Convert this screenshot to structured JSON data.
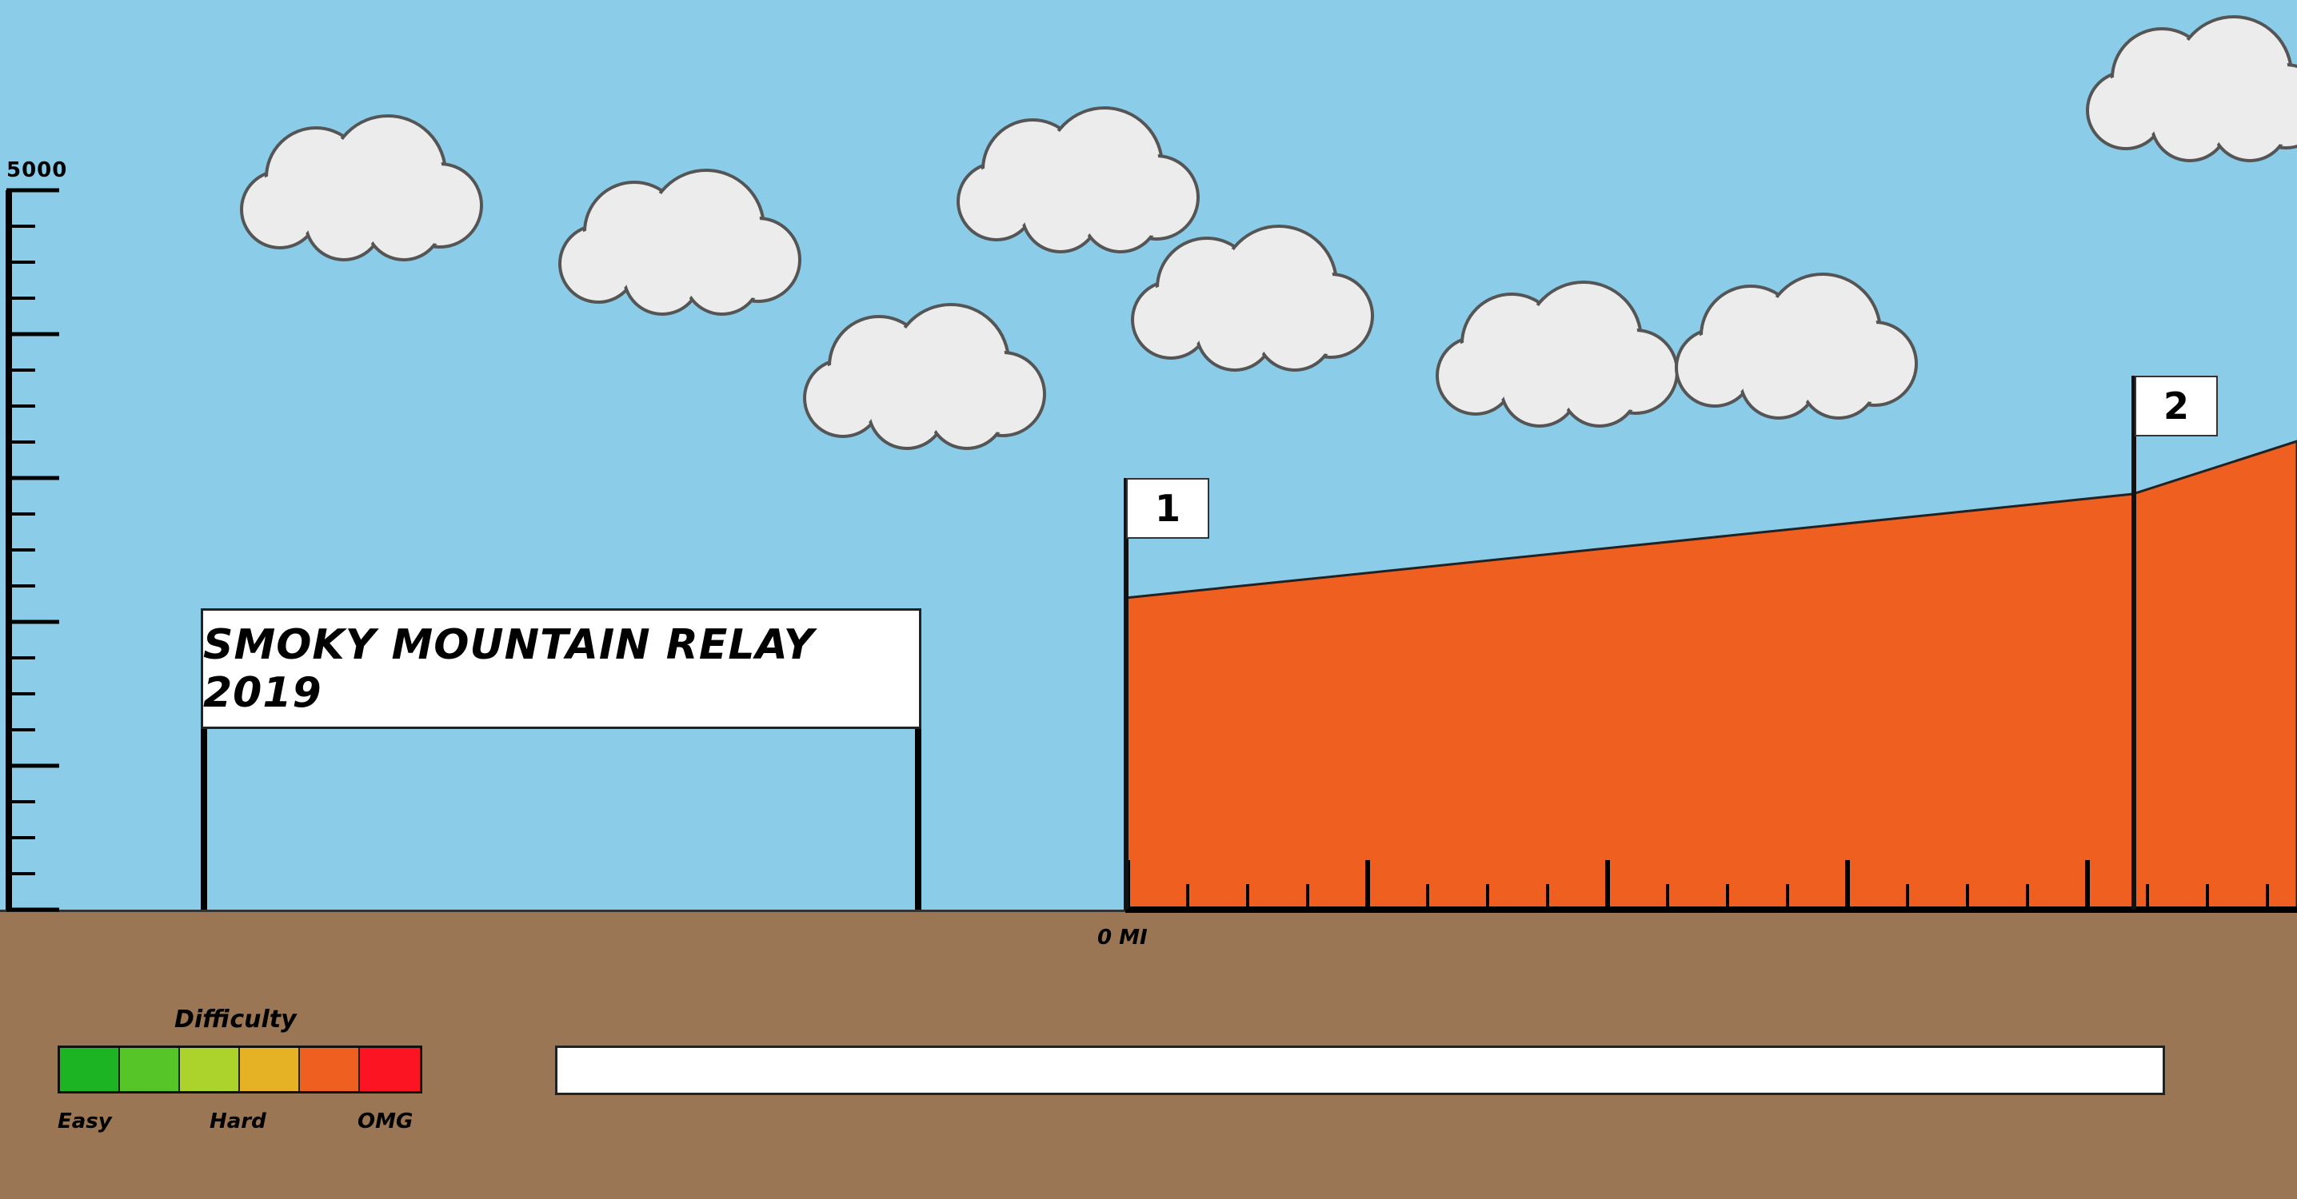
{
  "title": "SMOKY MOUNTAIN RELAY 2019",
  "elevation_axis": {
    "max_label": "5000"
  },
  "distance_axis": {
    "start_label": "0 MI"
  },
  "legs": [
    {
      "label": "1",
      "difficulty": "hard",
      "color": "#ef5f20"
    },
    {
      "label": "2",
      "difficulty": "hard",
      "color": "#ef5f20"
    }
  ],
  "difficulty": {
    "title": "Difficulty",
    "colors": [
      "#1db423",
      "#56c527",
      "#acd32b",
      "#e4b224",
      "#ef5f20",
      "#fd1422"
    ],
    "labels": {
      "easy": "Easy",
      "hard": "Hard",
      "omg": "OMG"
    }
  },
  "progress": {
    "value": 0
  },
  "colors": {
    "sky": "#8bcde9",
    "ground": "#9a7655",
    "cloud": "#ececec"
  }
}
